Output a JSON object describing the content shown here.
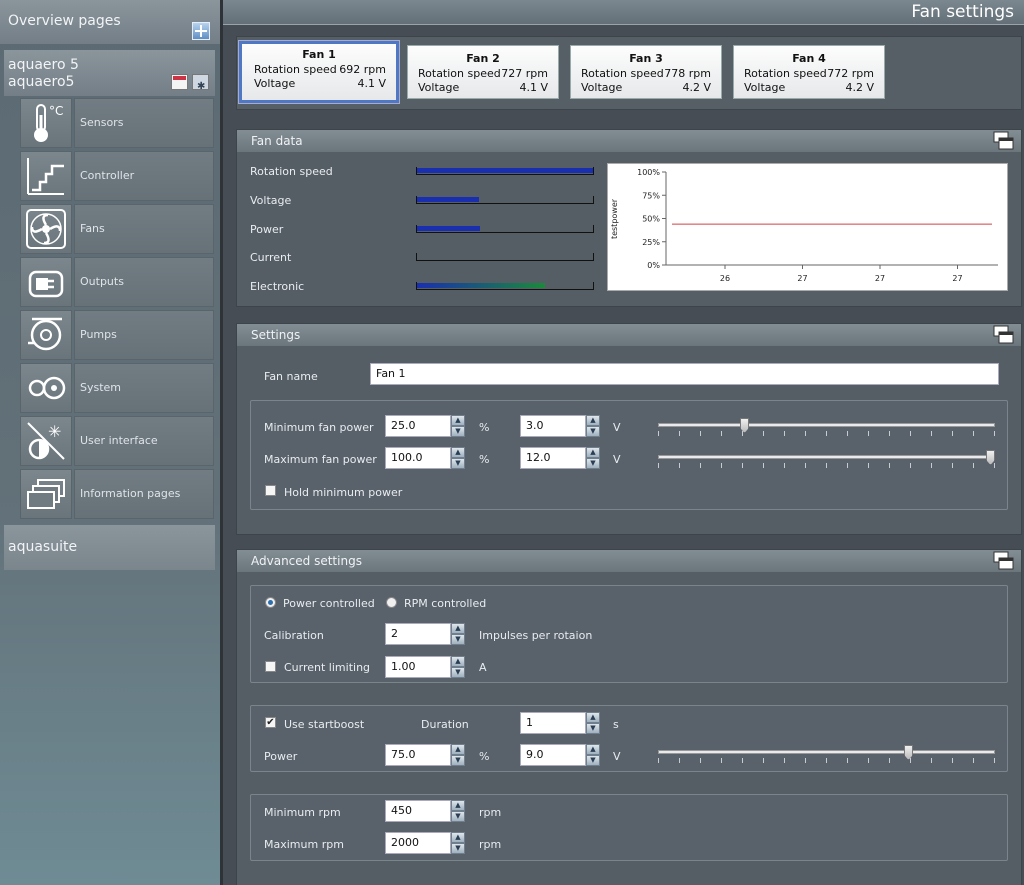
{
  "window": {
    "title": "Fan settings"
  },
  "sidebar": {
    "overview": "Overview pages",
    "device_line1": "aquaero 5",
    "device_line2": "aquaero5",
    "items": [
      {
        "label": "Sensors",
        "icon": "thermometer-icon"
      },
      {
        "label": "Controller",
        "icon": "controller-icon"
      },
      {
        "label": "Fans",
        "icon": "fan-icon"
      },
      {
        "label": "Outputs",
        "icon": "plug-icon"
      },
      {
        "label": "Pumps",
        "icon": "pump-icon"
      },
      {
        "label": "System",
        "icon": "system-icon"
      },
      {
        "label": "User interface",
        "icon": "user-interface-icon"
      },
      {
        "label": "Information pages",
        "icon": "pages-icon"
      }
    ],
    "suite": "aquasuite"
  },
  "fans": [
    {
      "name": "Fan 1",
      "speed_label": "Rotation speed",
      "speed": "692 rpm",
      "voltage_label": "Voltage",
      "voltage": "4.1 V"
    },
    {
      "name": "Fan 2",
      "speed_label": "Rotation speed",
      "speed": "727 rpm",
      "voltage_label": "Voltage",
      "voltage": "4.1 V"
    },
    {
      "name": "Fan 3",
      "speed_label": "Rotation speed",
      "speed": "778 rpm",
      "voltage_label": "Voltage",
      "voltage": "4.2 V"
    },
    {
      "name": "Fan 4",
      "speed_label": "Rotation speed",
      "speed": "772 rpm",
      "voltage_label": "Voltage",
      "voltage": "4.2 V"
    }
  ],
  "fan_data": {
    "title": "Fan data",
    "rows": [
      {
        "label": "Rotation speed",
        "fill": 1.0,
        "color": "#1a2fb0"
      },
      {
        "label": "Voltage",
        "fill": 0.35,
        "color": "#1a2fb0"
      },
      {
        "label": "Power",
        "fill": 0.36,
        "color": "#1a2fb0"
      },
      {
        "label": "Current",
        "fill": 0.0,
        "color": "#1a2fb0"
      },
      {
        "label": "Electronic",
        "fill": 0.73,
        "color": "#1a8a3a"
      }
    ]
  },
  "chart_data": {
    "type": "line",
    "ylabel": "testpower",
    "y_ticks": [
      "100%",
      "75%",
      "50%",
      "25%",
      "0%"
    ],
    "ylim": [
      0,
      100
    ],
    "x_ticks": [
      "26",
      "27",
      "27",
      "27"
    ],
    "series": [
      {
        "values": [
          44,
          44
        ],
        "color": "#d04040"
      }
    ]
  },
  "settings": {
    "title": "Settings",
    "fan_name_label": "Fan name",
    "fan_name": "Fan 1",
    "min_power_label": "Minimum fan power",
    "min_power": "25.0",
    "min_power_unit": "%",
    "min_voltage": "3.0",
    "min_voltage_unit": "V",
    "min_slider": 0.25,
    "max_power_label": "Maximum fan power",
    "max_power": "100.0",
    "max_power_unit": "%",
    "max_voltage": "12.0",
    "max_voltage_unit": "V",
    "max_slider": 1.0,
    "hold_min_label": "Hold minimum power",
    "hold_min_checked": false
  },
  "advanced": {
    "title": "Advanced settings",
    "mode_power": "Power controlled",
    "mode_rpm": "RPM controlled",
    "calibration_label": "Calibration",
    "calibration": "2",
    "calibration_unit": "Impulses per rotaion",
    "current_limiting_label": "Current limiting",
    "current_limiting": "1.00",
    "current_unit": "A",
    "startboost_label": "Use startboost",
    "startboost_checked": true,
    "duration_label": "Duration",
    "duration": "1",
    "duration_unit": "s",
    "power_label": "Power",
    "boost_power": "75.0",
    "boost_power_unit": "%",
    "boost_voltage": "9.0",
    "boost_voltage_unit": "V",
    "boost_slider": 0.75,
    "min_rpm_label": "Minimum rpm",
    "min_rpm": "450",
    "min_rpm_unit": "rpm",
    "max_rpm_label": "Maximum rpm",
    "max_rpm": "2000",
    "max_rpm_unit": "rpm"
  }
}
